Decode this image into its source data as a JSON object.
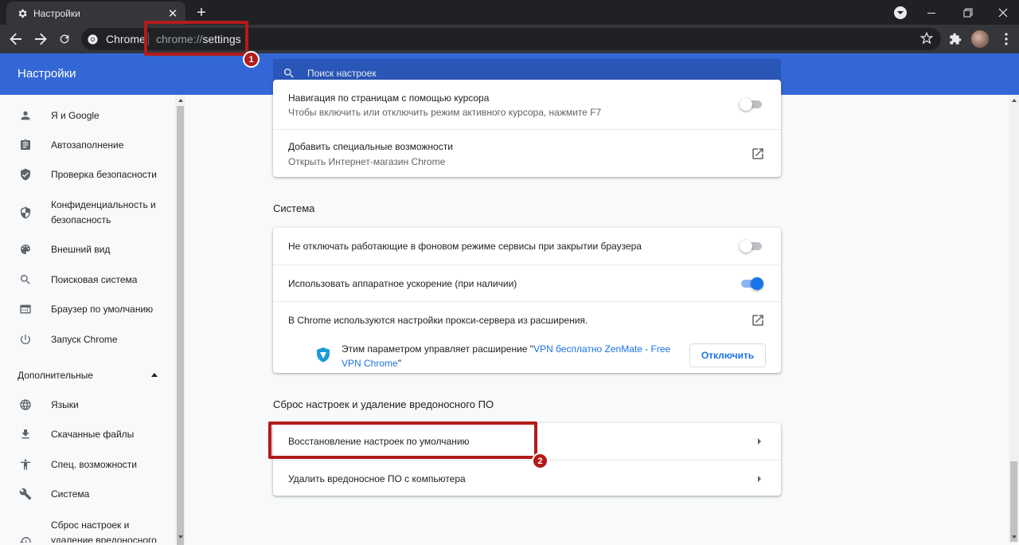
{
  "window": {
    "tab_title": "Настройки",
    "new_tab_icon": "plus-icon"
  },
  "toolbar": {
    "chip_label": "Chrome",
    "url_scheme": "chrome://",
    "url_path": "settings"
  },
  "header": {
    "title": "Настройки",
    "search_placeholder": "Поиск настроек",
    "accent_color": "#3367d6"
  },
  "sidebar": {
    "items": [
      {
        "label": "Я и Google",
        "icon": "person-icon"
      },
      {
        "label": "Автозаполнение",
        "icon": "clipboard-icon"
      },
      {
        "label": "Проверка безопасности",
        "icon": "shield-check-icon"
      },
      {
        "label": "Конфиденциальность и безопасность",
        "icon": "shield-icon"
      },
      {
        "label": "Внешний вид",
        "icon": "palette-icon"
      },
      {
        "label": "Поисковая система",
        "icon": "search-icon"
      },
      {
        "label": "Браузер по умолчанию",
        "icon": "browser-icon"
      },
      {
        "label": "Запуск Chrome",
        "icon": "power-icon"
      }
    ],
    "advanced_label": "Дополнительные",
    "advanced_items": [
      {
        "label": "Языки",
        "icon": "globe-icon"
      },
      {
        "label": "Скачанные файлы",
        "icon": "download-icon"
      },
      {
        "label": "Спец. возможности",
        "icon": "accessibility-icon"
      },
      {
        "label": "Система",
        "icon": "wrench-icon"
      },
      {
        "label": "Сброс настроек и удаление вредоносного ПО",
        "icon": "history-icon"
      }
    ]
  },
  "main": {
    "accessibility_card": {
      "caret_title": "Навигация по страницам с помощью курсора",
      "caret_sub": "Чтобы включить или отключить режим активного курсора, нажмите F7",
      "caret_toggle_on": false,
      "add_title": "Добавить специальные возможности",
      "add_sub": "Открыть Интернет-магазин Chrome"
    },
    "system_section": {
      "heading": "Система",
      "background_apps": "Не отключать работающие в фоновом режиме сервисы при закрытии браузера",
      "background_toggle_on": false,
      "hardware_accel": "Использовать аппаратное ускорение (при наличии)",
      "hardware_toggle_on": true,
      "proxy": "В Chrome используются настройки прокси-сервера из расширения.",
      "ext_prefix": "Этим параметром управляет расширение \"",
      "ext_link": "VPN бесплатно ZenMate - Free VPN Chrome",
      "ext_suffix": "\"",
      "disable_button": "Отключить"
    },
    "reset_section": {
      "heading": "Сброс настроек и удаление вредоносного ПО",
      "restore": "Восстановление настроек по умолчанию",
      "cleanup": "Удалить вредоносное ПО с компьютера"
    }
  },
  "annotations": {
    "badge1": "1",
    "badge2": "2",
    "highlight_color": "#b31b1b"
  }
}
